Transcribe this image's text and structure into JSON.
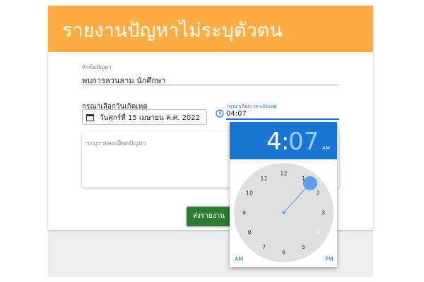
{
  "header": {
    "title": "รายงานปัญหาไม่ระบุตัวตน"
  },
  "subject": {
    "label": "หัวข้อปัญหา",
    "value": "พบการลวนลาม นักศึกษา"
  },
  "date": {
    "label": "กรุณาเลือกวันเกิดเหตุ",
    "value": "วันศุกร์ที่ 15 เมษายน ค.ศ. 2022",
    "icon": "calendar-icon"
  },
  "time": {
    "label": "กรุณาเลือกเวลาเกิดเหตุ",
    "value": "04:07",
    "icon": "clock-icon"
  },
  "description": {
    "placeholder": "ระบุรายละเอียดปัญหา"
  },
  "submit": {
    "label": "ส่งรายงาน"
  },
  "picker": {
    "hour": "4",
    "colon": ":",
    "minute": "07",
    "period": "AM",
    "am_label": "AM",
    "pm_label": "PM",
    "numbers": [
      "12",
      "1",
      "2",
      "3",
      "4",
      "5",
      "6",
      "7",
      "8",
      "9",
      "10",
      "11"
    ],
    "selected_minute": 7,
    "selected_hour": 4
  },
  "colors": {
    "header": "#ffad42",
    "accent": "#1976d2",
    "submit": "#2e7d32"
  }
}
